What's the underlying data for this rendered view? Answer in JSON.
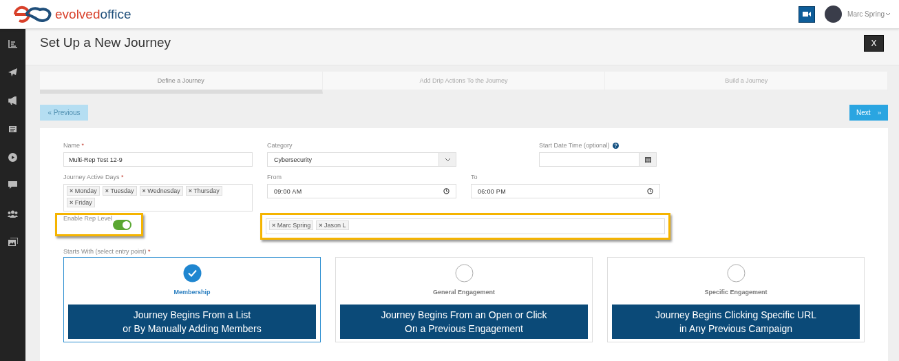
{
  "header": {
    "logo_text_bold": "evolved",
    "logo_text": "office",
    "user_name": "Marc Spring"
  },
  "sidebar": {
    "items": [
      {
        "kind": "chart",
        "selected": false
      },
      {
        "kind": "plane",
        "selected": false
      },
      {
        "kind": "megaphone",
        "selected": false
      },
      {
        "kind": "news",
        "selected": false
      },
      {
        "kind": "play",
        "selected": false
      },
      {
        "kind": "chat",
        "selected": false
      },
      {
        "kind": "users",
        "selected": false
      },
      {
        "kind": "images",
        "selected": false
      }
    ]
  },
  "page": {
    "title": "Set Up a New Journey",
    "close_label": "X"
  },
  "steps": [
    {
      "label": "Define a Journey",
      "selected": true
    },
    {
      "label": "Add Drip Actions To the Journey",
      "selected": false
    },
    {
      "label": "Build a Journey",
      "selected": false
    }
  ],
  "nav": {
    "previous": {
      "label": "« Previous",
      "disabled": true
    },
    "next": {
      "label": "Next",
      "disabled": false
    }
  },
  "form": {
    "name": {
      "label": "Name",
      "mark": "*",
      "value": "Multi-Rep Test 12-9"
    },
    "category": {
      "label": "Category",
      "value": "Cybersecurity"
    },
    "start_date": {
      "label": "Start Date Time (optional)"
    },
    "active_days": {
      "label": "Journey Active Days",
      "mark": "*",
      "chips": [
        {
          "remove": "×",
          "label": "Monday"
        },
        {
          "remove": "×",
          "label": "Tuesday"
        },
        {
          "remove": "×",
          "label": "Wednesday"
        },
        {
          "remove": "×",
          "label": "Thursday"
        },
        {
          "remove": "×",
          "label": "Friday"
        }
      ]
    },
    "from": {
      "label": "From",
      "value": "09:00 AM"
    },
    "to": {
      "label": "To",
      "value": "06:00 PM"
    },
    "rep_level": {
      "label": "Enable Rep Level",
      "on": true,
      "highlighted": true
    },
    "reps": {
      "chips": [
        {
          "remove": "×",
          "label": "Marc Spring"
        },
        {
          "remove": "×",
          "label": "Jason L"
        }
      ],
      "highlighted": true
    },
    "starts_with": {
      "label": "Starts With (select entry point)",
      "mark": "*"
    },
    "entry_points": [
      {
        "title": "Membership",
        "description": [
          "Journey Begins From a List",
          "or By Manually Adding Members"
        ],
        "selected": true
      },
      {
        "title": "General Engagement",
        "description": [
          "Journey Begins From an Open or Click",
          "On a Previous Engagement"
        ],
        "selected": false
      },
      {
        "title": "Specific Engagement",
        "description": [
          "Journey Begins Clicking Specific URL",
          "in Any Previous Campaign"
        ],
        "selected": false
      }
    ]
  }
}
